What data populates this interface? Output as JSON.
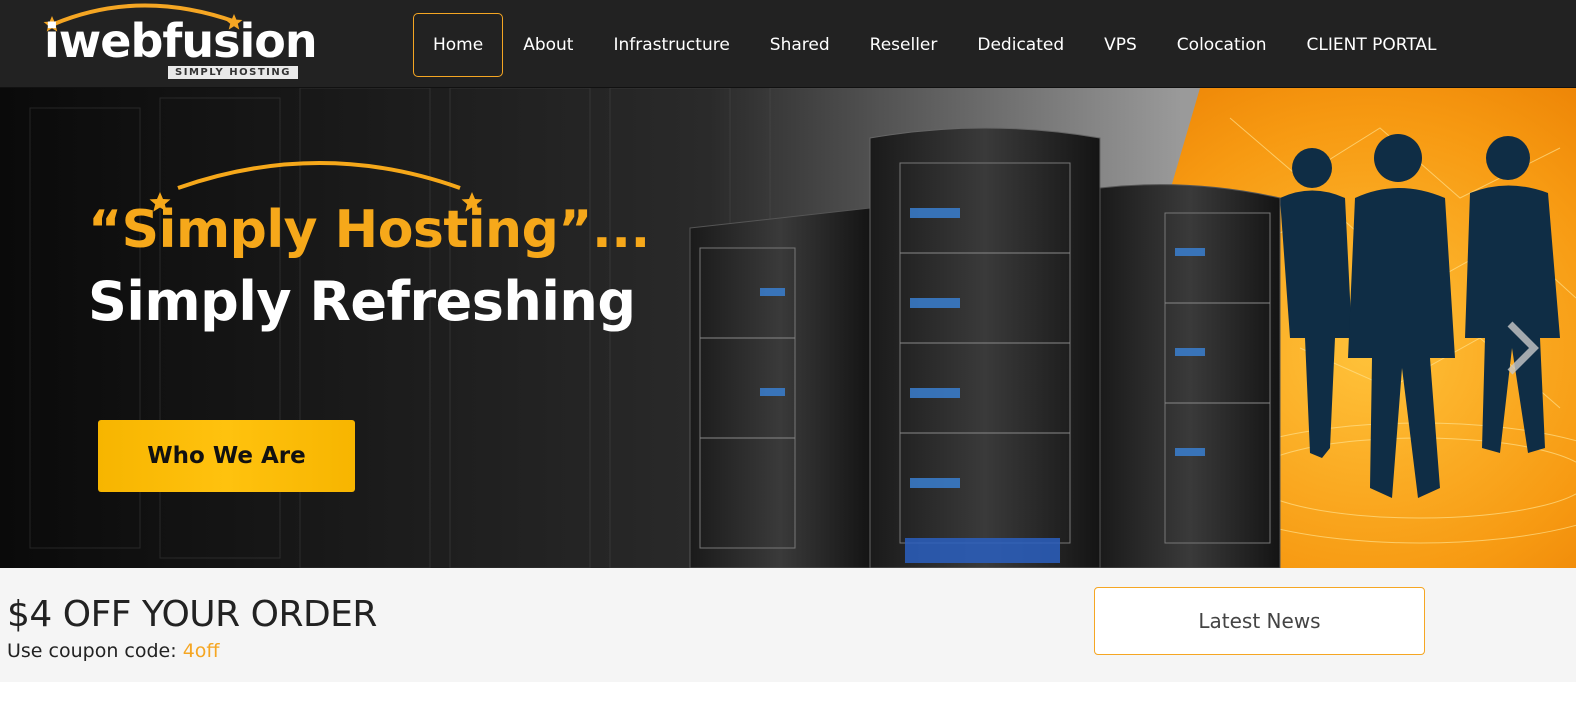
{
  "brand": {
    "name": "iwebfusion",
    "tagline": "SIMPLY HOSTING",
    "accent_color": "#f5a623"
  },
  "nav": {
    "items": [
      {
        "label": "Home",
        "active": true
      },
      {
        "label": "About"
      },
      {
        "label": "Infrastructure"
      },
      {
        "label": "Shared"
      },
      {
        "label": "Reseller"
      },
      {
        "label": "Dedicated"
      },
      {
        "label": "VPS"
      },
      {
        "label": "Colocation"
      },
      {
        "label": "CLIENT PORTAL"
      }
    ]
  },
  "hero": {
    "headline": "“Simply Hosting”...",
    "subheadline": "Simply Refreshing",
    "cta_label": "Who We Are",
    "next_icon": "chevron-right-icon"
  },
  "promo": {
    "title": "$4 OFF YOUR ORDER",
    "coupon_prefix": "Use coupon code: ",
    "coupon_code": "4off",
    "news_button": "Latest News"
  }
}
